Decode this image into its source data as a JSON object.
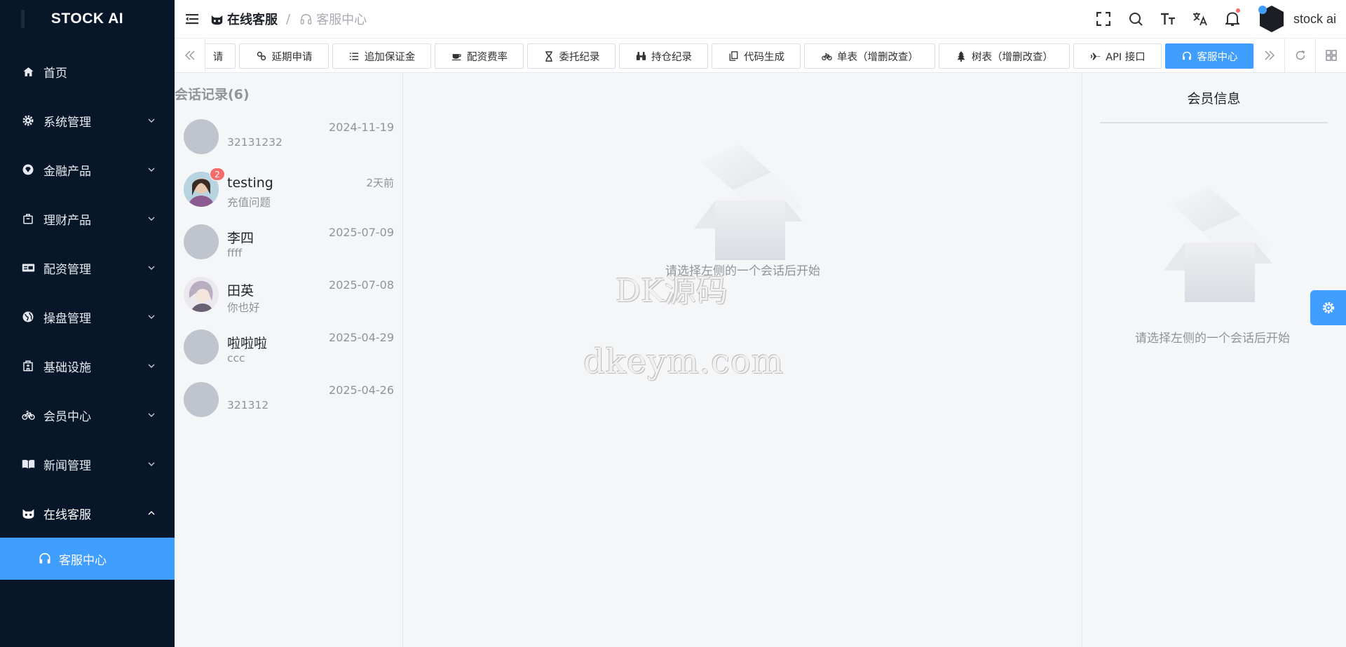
{
  "brand": {
    "name": "STOCK AI"
  },
  "sidebar": {
    "items": [
      {
        "label": "首页",
        "icon": "home-icon",
        "has_children": false
      },
      {
        "label": "系统管理",
        "icon": "gear-icon",
        "has_children": true
      },
      {
        "label": "金融产品",
        "icon": "diamond-icon",
        "has_children": true
      },
      {
        "label": "理财产品",
        "icon": "bag-icon",
        "has_children": true
      },
      {
        "label": "配资管理",
        "icon": "card-icon",
        "has_children": true
      },
      {
        "label": "操盘管理",
        "icon": "globe-icon",
        "has_children": true
      },
      {
        "label": "基础设施",
        "icon": "building-icon",
        "has_children": true
      },
      {
        "label": "会员中心",
        "icon": "bike-icon",
        "has_children": true
      },
      {
        "label": "新闻管理",
        "icon": "book-icon",
        "has_children": true
      },
      {
        "label": "在线客服",
        "icon": "cat-icon",
        "has_children": true,
        "expanded": true
      }
    ],
    "sub_items": [
      {
        "label": "客服中心",
        "icon": "headset-icon",
        "active": true
      }
    ]
  },
  "header": {
    "breadcrumb": [
      {
        "label": "在线客服",
        "icon": "cat-icon"
      },
      {
        "label": "客服中心",
        "icon": "headset-icon"
      }
    ],
    "separator": "/",
    "user_name": "stock ai",
    "notification_dot": true
  },
  "tags": [
    {
      "label": "请",
      "icon": ""
    },
    {
      "label": "延期申请",
      "icon": "link-icon"
    },
    {
      "label": "追加保证金",
      "icon": "list-icon"
    },
    {
      "label": "配资费率",
      "icon": "cup-icon"
    },
    {
      "label": "委托纪录",
      "icon": "hourglass-icon"
    },
    {
      "label": "持仓纪录",
      "icon": "binoculars-icon"
    },
    {
      "label": "代码生成",
      "icon": "copy-icon"
    },
    {
      "label": "单表（增删改查）",
      "icon": "bike-icon"
    },
    {
      "label": "树表（增删改查）",
      "icon": "tree-icon"
    },
    {
      "label": "API 接口",
      "icon": "plane-icon"
    },
    {
      "label": "客服中心",
      "icon": "headset-icon",
      "active": true
    }
  ],
  "conversations": {
    "title": "会话记录(6)",
    "items": [
      {
        "name": "",
        "message": "32131232",
        "time": "2024-11-19",
        "badge": "",
        "avatar": "default"
      },
      {
        "name": "testing",
        "message": "充值问题",
        "time": "2天前",
        "badge": "2",
        "avatar": "photo-girl"
      },
      {
        "name": "李四",
        "message": "ffff",
        "time": "2025-07-09",
        "badge": "",
        "avatar": "default"
      },
      {
        "name": "田英",
        "message": "你也好",
        "time": "2025-07-08",
        "badge": "",
        "avatar": "photo-anime"
      },
      {
        "name": "啦啦啦",
        "message": "ccc",
        "time": "2025-04-29",
        "badge": "",
        "avatar": "default"
      },
      {
        "name": "",
        "message": "321312",
        "time": "2025-04-26",
        "badge": "",
        "avatar": "default"
      }
    ]
  },
  "chat_empty": {
    "text": "请选择左侧的一个会话后开始"
  },
  "member_info": {
    "title": "会员信息",
    "empty_text": "请选择左侧的一个会话后开始"
  },
  "watermark": {
    "line1": "DK源码",
    "line2": "dkeym.com"
  },
  "colors": {
    "sidebar_bg": "#071628",
    "accent": "#409eff",
    "badge": "#f56c6c"
  }
}
